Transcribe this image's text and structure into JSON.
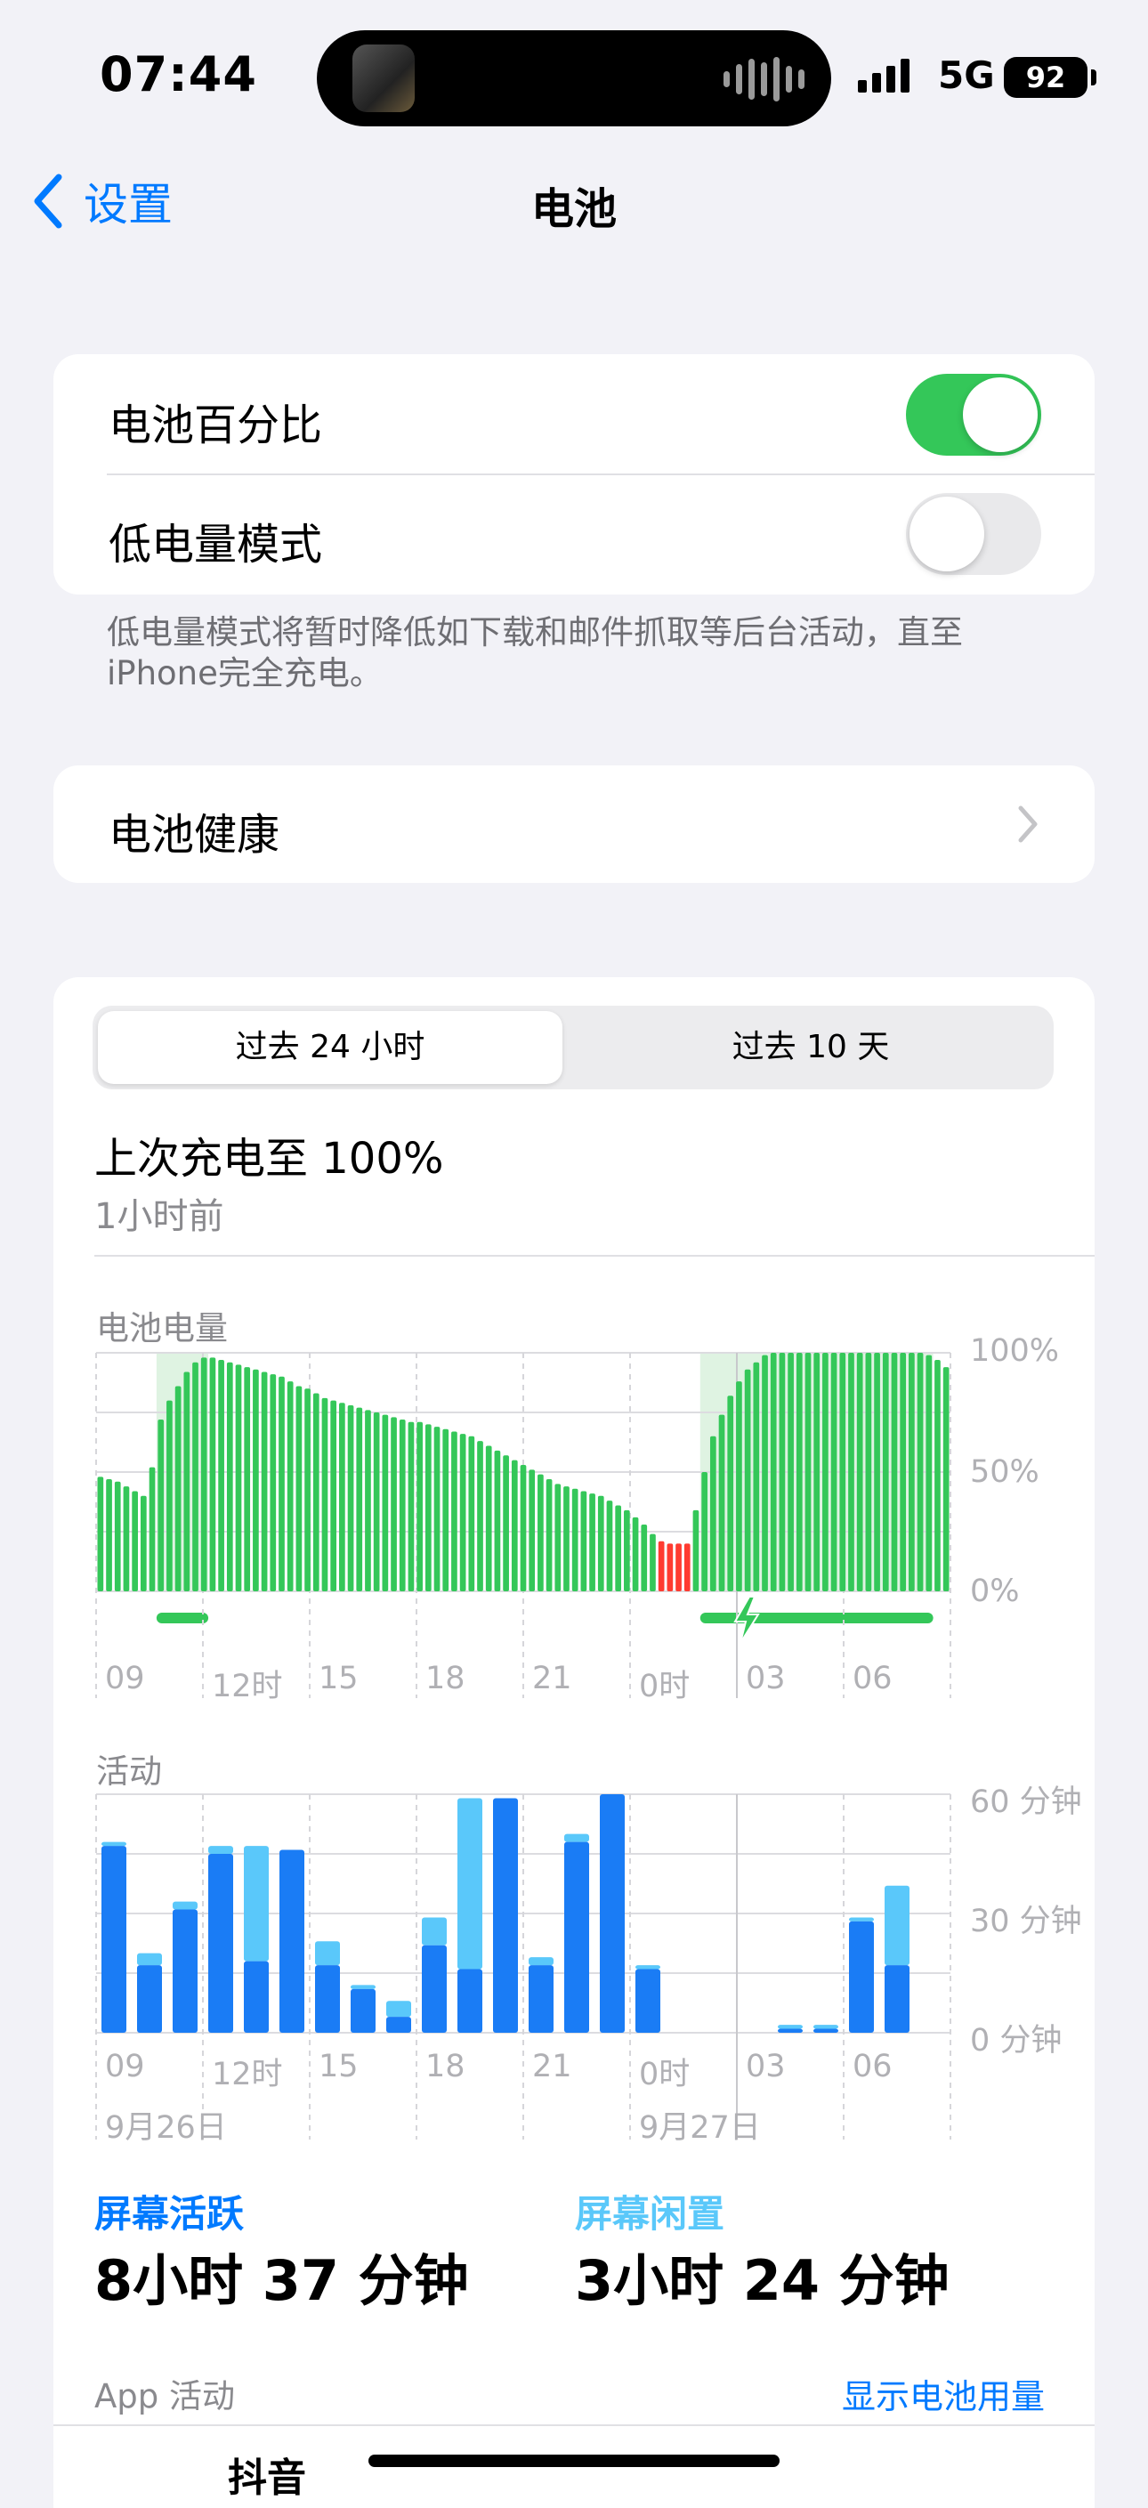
{
  "status_bar": {
    "time": "07:44",
    "network": "5G",
    "battery": "92"
  },
  "nav": {
    "back_label": "设置",
    "title": "电池"
  },
  "settings": {
    "battery_percentage_label": "电池百分比",
    "battery_percentage_on": true,
    "low_power_label": "低电量模式",
    "low_power_on": false,
    "low_power_footnote": "低电量模式将暂时降低如下载和邮件抓取等后台活动，直至iPhone完全充电。",
    "battery_health_label": "电池健康"
  },
  "usage": {
    "tabs": [
      "过去 24 小时",
      "过去 10 天"
    ],
    "selected_tab": 0,
    "last_charge_title": "上次充电至 100%",
    "last_charge_sub": "1小时前",
    "level_title": "电池电量",
    "activity_title": "活动",
    "x_ticks": [
      "09",
      "12时",
      "15",
      "18",
      "21",
      "0时",
      "03",
      "06"
    ],
    "dates": [
      "9月26日",
      "9月27日"
    ],
    "screen_on_label": "屏幕活跃",
    "screen_on_value": "8小时 37 分钟",
    "screen_off_label": "屏幕闲置",
    "screen_off_value": "3小时 24 分钟",
    "app_activity_label": "App 活动",
    "show_usage_label": "显示电池用量",
    "first_app": "抖音"
  },
  "colors": {
    "accent": "#007aff",
    "green": "#34c759",
    "red": "#ff3b30",
    "active": "#1a7cf5",
    "idle": "#5ac8fa"
  },
  "chart_data": [
    {
      "type": "bar",
      "title": "电池电量",
      "ylim": [
        0,
        100
      ],
      "y_ticks": [
        "100%",
        "50%",
        "0%"
      ],
      "x_ticks": [
        "09",
        "12时",
        "15",
        "18",
        "21",
        "0时",
        "03",
        "06"
      ],
      "values": [
        48,
        47,
        46,
        44,
        42,
        40,
        52,
        72,
        80,
        86,
        92,
        96,
        98,
        98,
        97,
        96,
        95,
        94,
        93,
        92,
        91,
        90,
        88,
        86,
        85,
        83,
        81,
        80,
        79,
        78,
        77,
        76,
        75,
        74,
        73,
        72,
        71,
        71,
        70,
        69,
        68,
        67,
        66,
        65,
        63,
        61,
        59,
        57,
        55,
        53,
        51,
        49,
        47,
        45,
        44,
        43,
        42,
        41,
        40,
        38,
        36,
        34,
        31,
        28,
        24,
        21,
        20,
        20,
        20,
        34,
        50,
        65,
        74,
        82,
        88,
        93,
        96,
        99,
        100,
        100,
        100,
        100,
        100,
        100,
        100,
        100,
        100,
        100,
        100,
        100,
        100,
        100,
        100,
        100,
        100,
        100,
        99,
        97,
        94
      ],
      "charging_ranges": [
        [
          7,
          13
        ],
        [
          70,
          97
        ]
      ]
    },
    {
      "type": "bar",
      "title": "活动",
      "ylim": [
        0,
        60
      ],
      "y_ticks": [
        "60 分钟",
        "30 分钟",
        "0 分钟"
      ],
      "x_ticks": [
        "09",
        "12时",
        "15",
        "18",
        "21",
        "0时",
        "03",
        "06"
      ],
      "series": [
        {
          "name": "屏幕活跃",
          "values": [
            47,
            17,
            31,
            45,
            18,
            46,
            17,
            11,
            4,
            22,
            16,
            59,
            17,
            48,
            60,
            16,
            0,
            0,
            0,
            1,
            1,
            28,
            17
          ]
        },
        {
          "name": "屏幕闲置",
          "values": [
            1,
            3,
            2,
            2,
            29,
            0,
            6,
            1,
            4,
            7,
            43,
            0,
            2,
            2,
            0,
            1,
            0,
            0,
            0,
            1,
            1,
            1,
            20
          ]
        }
      ]
    }
  ]
}
